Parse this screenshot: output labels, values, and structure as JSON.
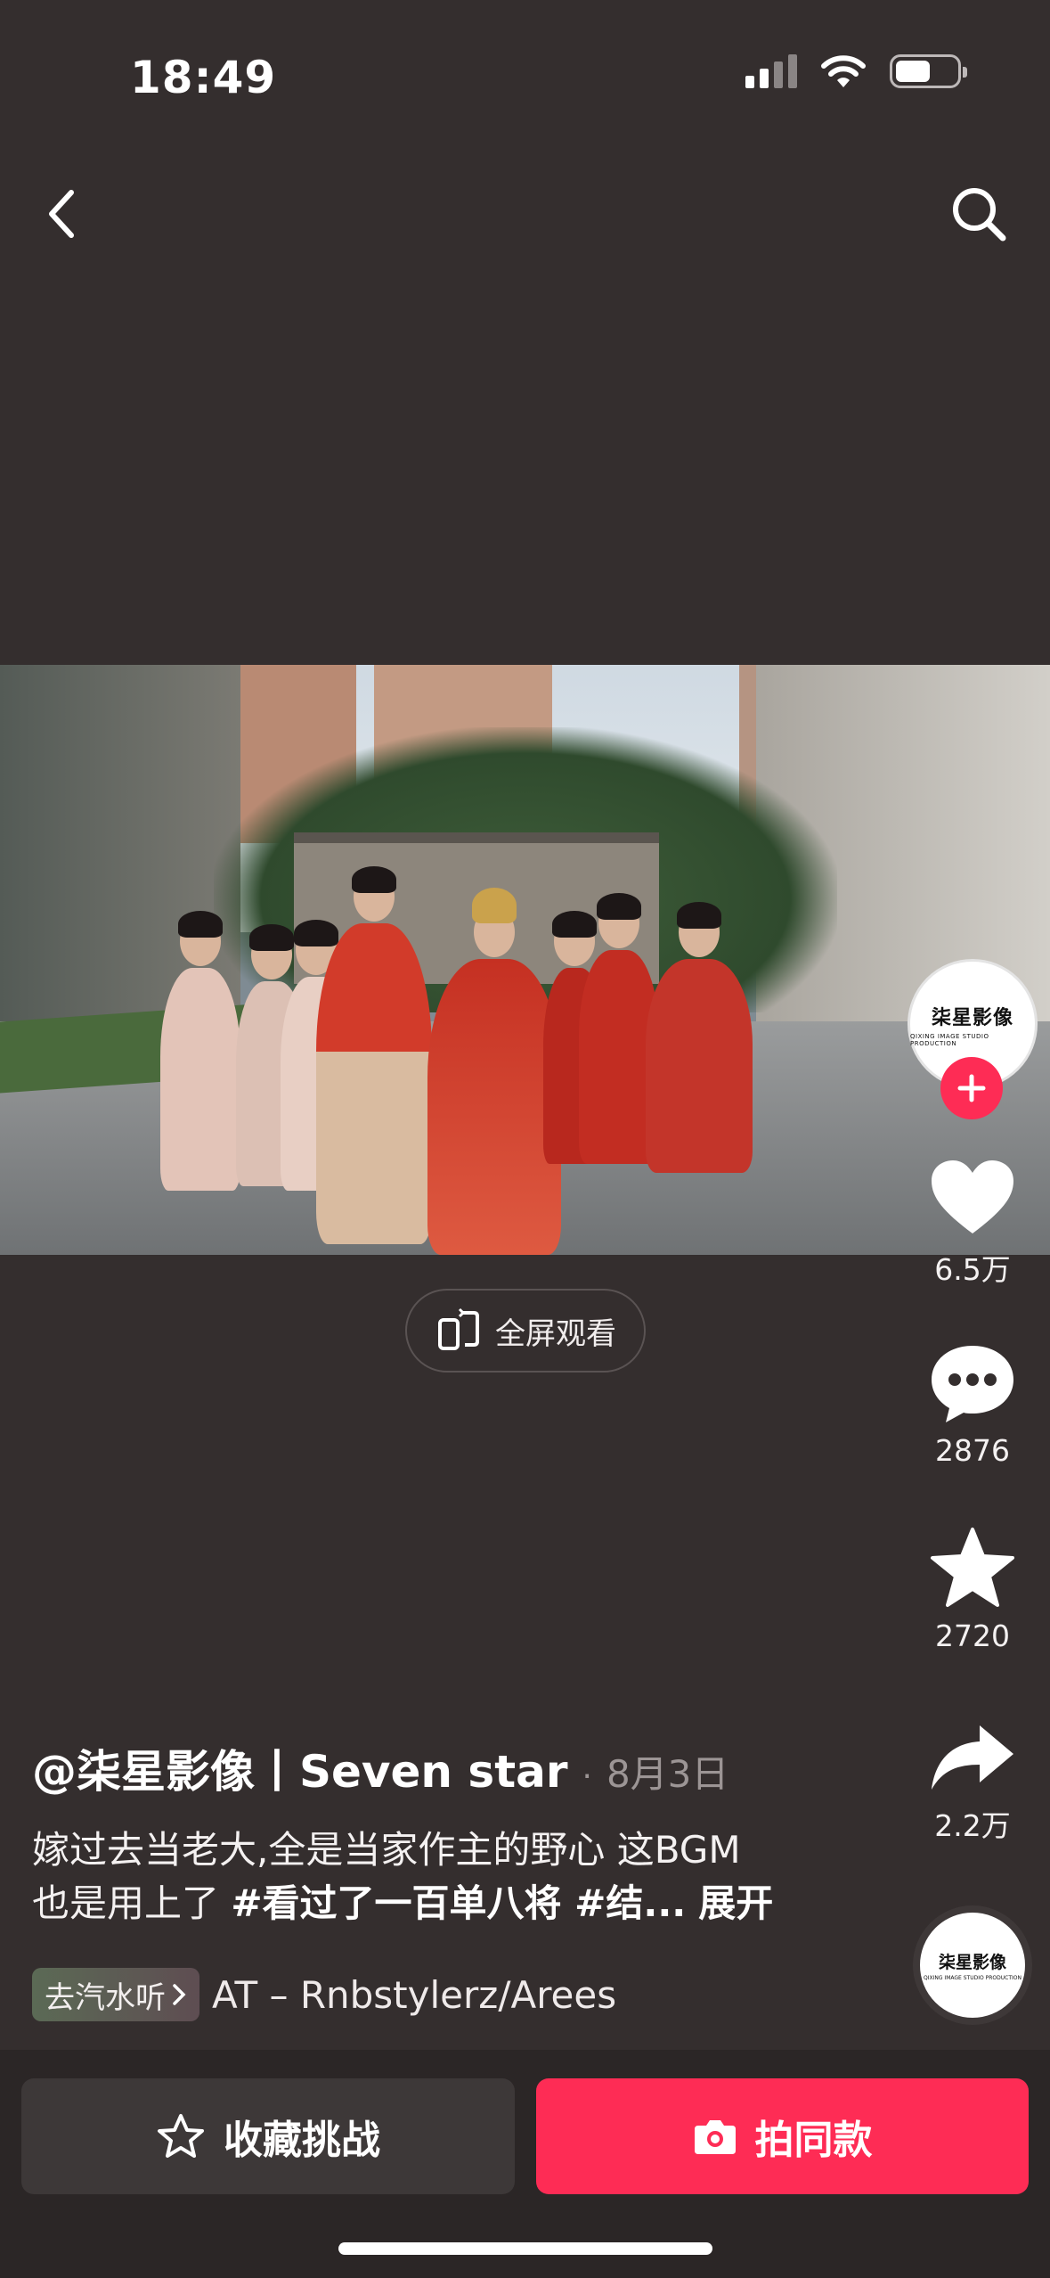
{
  "status_bar": {
    "time": "18:49"
  },
  "nav": {
    "back_icon": "chevron-left-icon",
    "search_icon": "search-icon"
  },
  "player": {
    "fullscreen_label": "全屏观看"
  },
  "creator": {
    "avatar_logo_text": "柒星影像",
    "avatar_logo_subtext": "QIXING IMAGE STUDIO PRODUCTION"
  },
  "actions": {
    "like_count": "6.5万",
    "comment_count": "2876",
    "favorite_count": "2720",
    "share_count": "2.2万"
  },
  "post": {
    "author": "@柒星影像丨Seven star",
    "separator": "·",
    "date": "8月3日",
    "description_line1": "嫁过去当老大,全是当家作主的野心 这BGM",
    "description_line2_prefix": "也是用上了 ",
    "description_tags": "#看过了一百单八将 #结...",
    "expand_label": "展开"
  },
  "music": {
    "badge_label": "去汽水听",
    "title": "AT – Rnbstylerz/Arees"
  },
  "bottom": {
    "collect_label": "收藏挑战",
    "shoot_label": "拍同款"
  },
  "colors": {
    "background": "#342e2e",
    "accent": "#fe2c55",
    "secondary_button": "#3d3838"
  }
}
